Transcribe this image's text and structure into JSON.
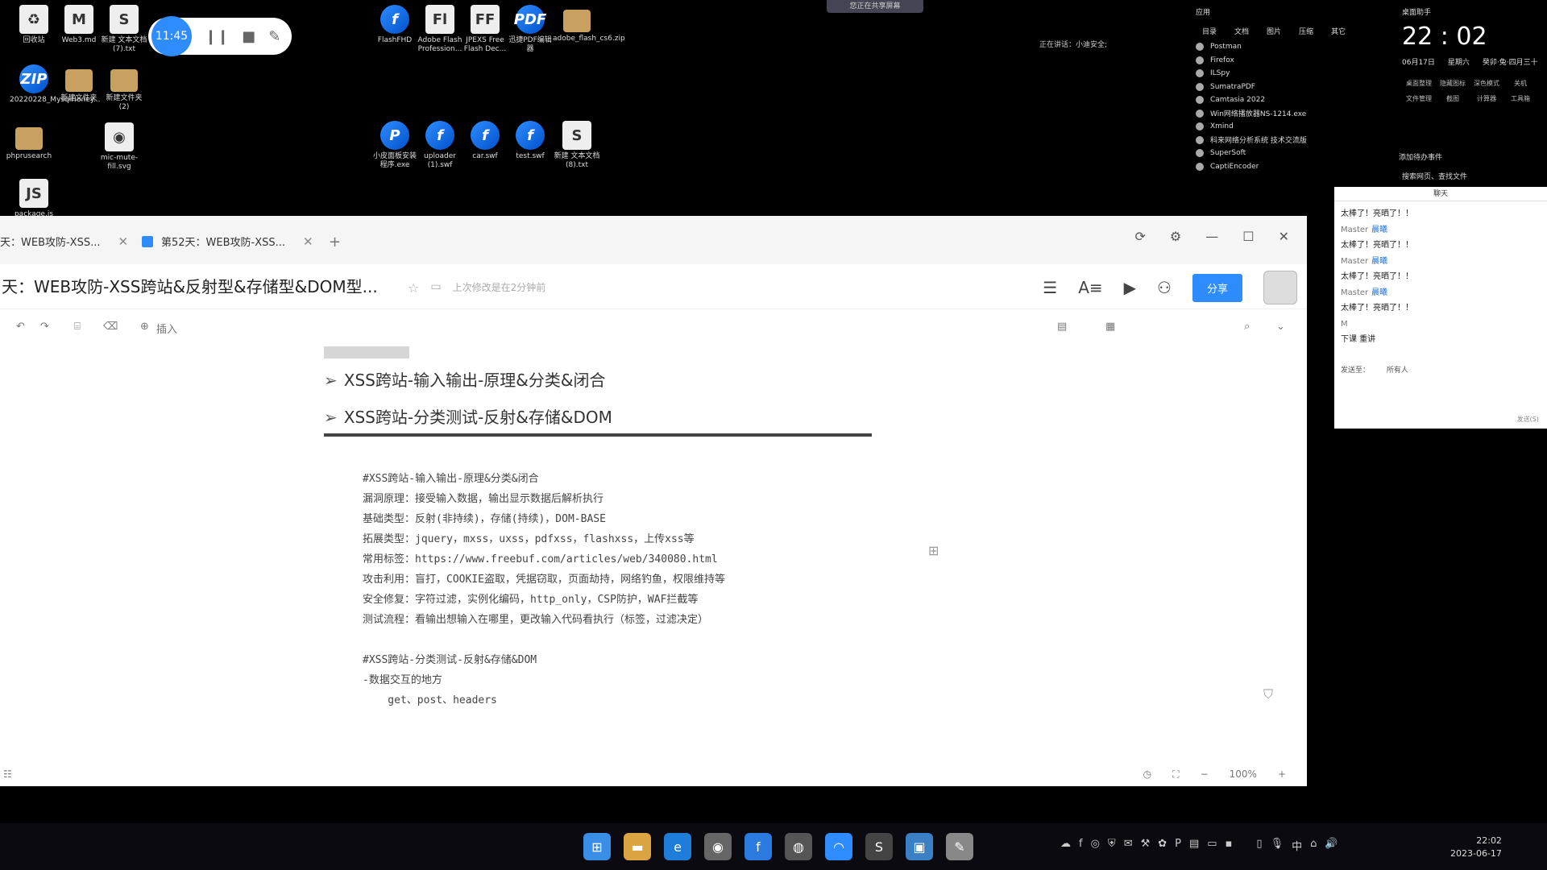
{
  "desktop": {
    "icons": [
      {
        "label": "回收站",
        "glyph": "♻",
        "kind": "doc"
      },
      {
        "label": "Web3.md",
        "glyph": "M",
        "kind": "doc"
      },
      {
        "label": "新建 文本文档 (7).txt",
        "glyph": "S",
        "kind": "doc"
      },
      {
        "label": "20220228_MysqlHoney...",
        "glyph": "ZIP",
        "kind": "flash"
      },
      {
        "label": "新建文件夹",
        "glyph": "",
        "kind": "folder"
      },
      {
        "label": "新建文件夹 (2)",
        "glyph": "",
        "kind": "folder"
      },
      {
        "label": "phprusearch",
        "glyph": "",
        "kind": "folder"
      },
      {
        "label": "mic-mute-fill.svg",
        "glyph": "◉",
        "kind": "doc"
      },
      {
        "label": "package.js",
        "glyph": "JS",
        "kind": "doc"
      },
      {
        "label": "FlashFHD",
        "glyph": "f",
        "kind": "flash"
      },
      {
        "label": "Adobe Flash Profession...",
        "glyph": "Fl",
        "kind": "doc"
      },
      {
        "label": "JPEXS Free Flash Dec...",
        "glyph": "FF",
        "kind": "doc"
      },
      {
        "label": "迅捷PDF编辑器",
        "glyph": "PDF",
        "kind": "flash"
      },
      {
        "label": "adobe_flash_cs6.zip",
        "glyph": "",
        "kind": "folder"
      },
      {
        "label": "小皮面板安装程序.exe",
        "glyph": "P",
        "kind": "flash"
      },
      {
        "label": "uploader (1).swf",
        "glyph": "f",
        "kind": "flash"
      },
      {
        "label": "car.swf",
        "glyph": "f",
        "kind": "flash"
      },
      {
        "label": "test.swf",
        "glyph": "f",
        "kind": "flash"
      },
      {
        "label": "新建 文本文档 (8).txt",
        "glyph": "S",
        "kind": "doc"
      }
    ],
    "recorder_time": "11:45",
    "share_bar": "您正在共享屏幕",
    "speaking": "正在讲话：小迪安全;"
  },
  "start_menu": {
    "header": "应用",
    "cols": [
      "目录",
      "文档",
      "图片",
      "压缩",
      "其它"
    ],
    "items": [
      "Postman",
      "Firefox",
      "ILSpy",
      "SumatraPDF",
      "Camtasia 2022",
      "Win网络播放器NS-1214.exe",
      "Xmind",
      "科来网络分析系统 技术交流版",
      "SuperSoft",
      "CaptiEncoder"
    ]
  },
  "widget": {
    "title": "桌面助手",
    "clock": "22 : 02",
    "date": "06月17日",
    "weekday": "星期六",
    "lunar": "癸卯·兔·四月三十",
    "grid": [
      "桌面整理",
      "隐藏图标",
      "深色模式",
      "关机",
      "文件管理",
      "截图",
      "计算器",
      "工具箱"
    ],
    "footer": "添加待办事件",
    "search": "搜索网页、查找文件"
  },
  "chat": {
    "title": "聊天",
    "messages": [
      {
        "type": "text",
        "text": "太棒了！亮晒了！！"
      },
      {
        "type": "sender",
        "who": "Master",
        "to": "晨曦"
      },
      {
        "type": "text",
        "text": "太棒了！亮晒了！！"
      },
      {
        "type": "sender",
        "who": "Master",
        "to": "晨曦"
      },
      {
        "type": "text",
        "text": "太棒了！亮晒了！！"
      },
      {
        "type": "sender",
        "who": "Master",
        "to": "晨曦"
      },
      {
        "type": "text",
        "text": "太棒了！亮晒了！！"
      },
      {
        "type": "sender",
        "who": "M",
        "to": ""
      },
      {
        "type": "text",
        "text": "下课 重讲"
      }
    ],
    "send_to_label": "发送至：",
    "send_to_value": "所有人",
    "send": "发送(S)"
  },
  "app": {
    "tabs": [
      "天：WEB攻防-XSS...",
      "第52天：WEB攻防-XSS..."
    ],
    "new_tab": "+",
    "title": "天：WEB攻防-XSS跨站&反射型&存储型&DOM型...",
    "save_status": "上次修改是在2分钟前",
    "share": "分享",
    "insert": "插入",
    "headings": [
      "XSS跨站-输入输出-原理&分类&闭合",
      "XSS跨站-分类测试-反射&存储&DOM"
    ],
    "code_lines": [
      "#XSS跨站-输入输出-原理&分类&闭合",
      "漏洞原理：接受输入数据，输出显示数据后解析执行",
      "基础类型：反射(非持续)，存储(持续)，DOM-BASE",
      "拓展类型：jquery，mxss，uxss，pdfxss，flashxss，上传xss等",
      "常用标签：https://www.freebuf.com/articles/web/340080.html",
      "攻击利用：盲打，COOKIE盗取，凭据窃取，页面劫持，网络钓鱼，权限维持等",
      "安全修复：字符过滤，实例化编码，http_only，CSP防护，WAF拦截等",
      "测试流程：看输出想输入在哪里，更改输入代码看执行（标签，过滤决定）",
      "",
      "#XSS跨站-分类测试-反射&存储&DOM",
      "-数据交互的地方",
      "    get、post、headers"
    ],
    "zoom": "100%"
  },
  "taskbar": {
    "time": "22:02",
    "date": "2023-06-17",
    "ime": "中"
  }
}
